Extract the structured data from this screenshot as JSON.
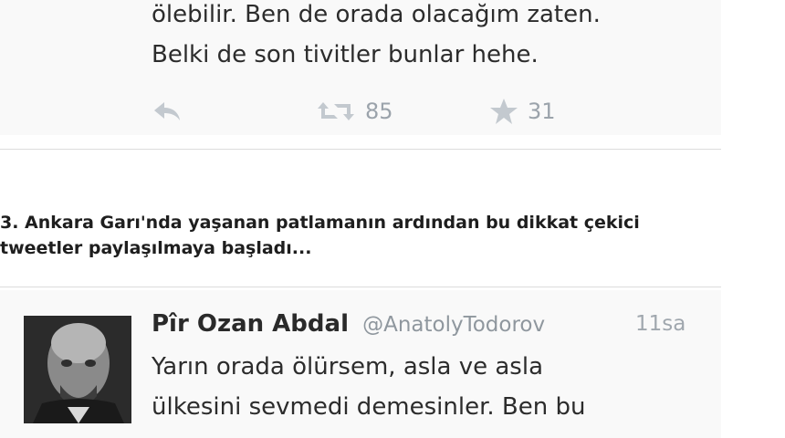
{
  "tweet_top": {
    "text_lines": [
      "ölebilir. Ben de orada olacağım zaten.",
      "Belki de son tivitler bunlar hehe."
    ],
    "retweet_count": "85",
    "favorite_count": "31"
  },
  "section": {
    "heading_lines": [
      "3. Ankara Garı'nda yaşanan patlamanın ardından bu dikkat çekici",
      "tweetler paylaşılmaya başladı..."
    ]
  },
  "tweet_bottom": {
    "author_name": "Pîr Ozan Abdal",
    "author_handle": "@AnatolyTodorov",
    "timestamp": "11sa",
    "text_lines": [
      "Yarın orada ölürsem, asla ve asla",
      "ülkesini sevmedi demesinler. Ben bu"
    ]
  },
  "icons": {
    "reply": "reply-icon",
    "retweet": "retweet-icon",
    "favorite": "star-icon"
  },
  "colors": {
    "tweet_background": "#f9f9f9",
    "text": "#2c2c2c",
    "action_icon": "#b8bfc6",
    "handle": "#8f979e"
  }
}
